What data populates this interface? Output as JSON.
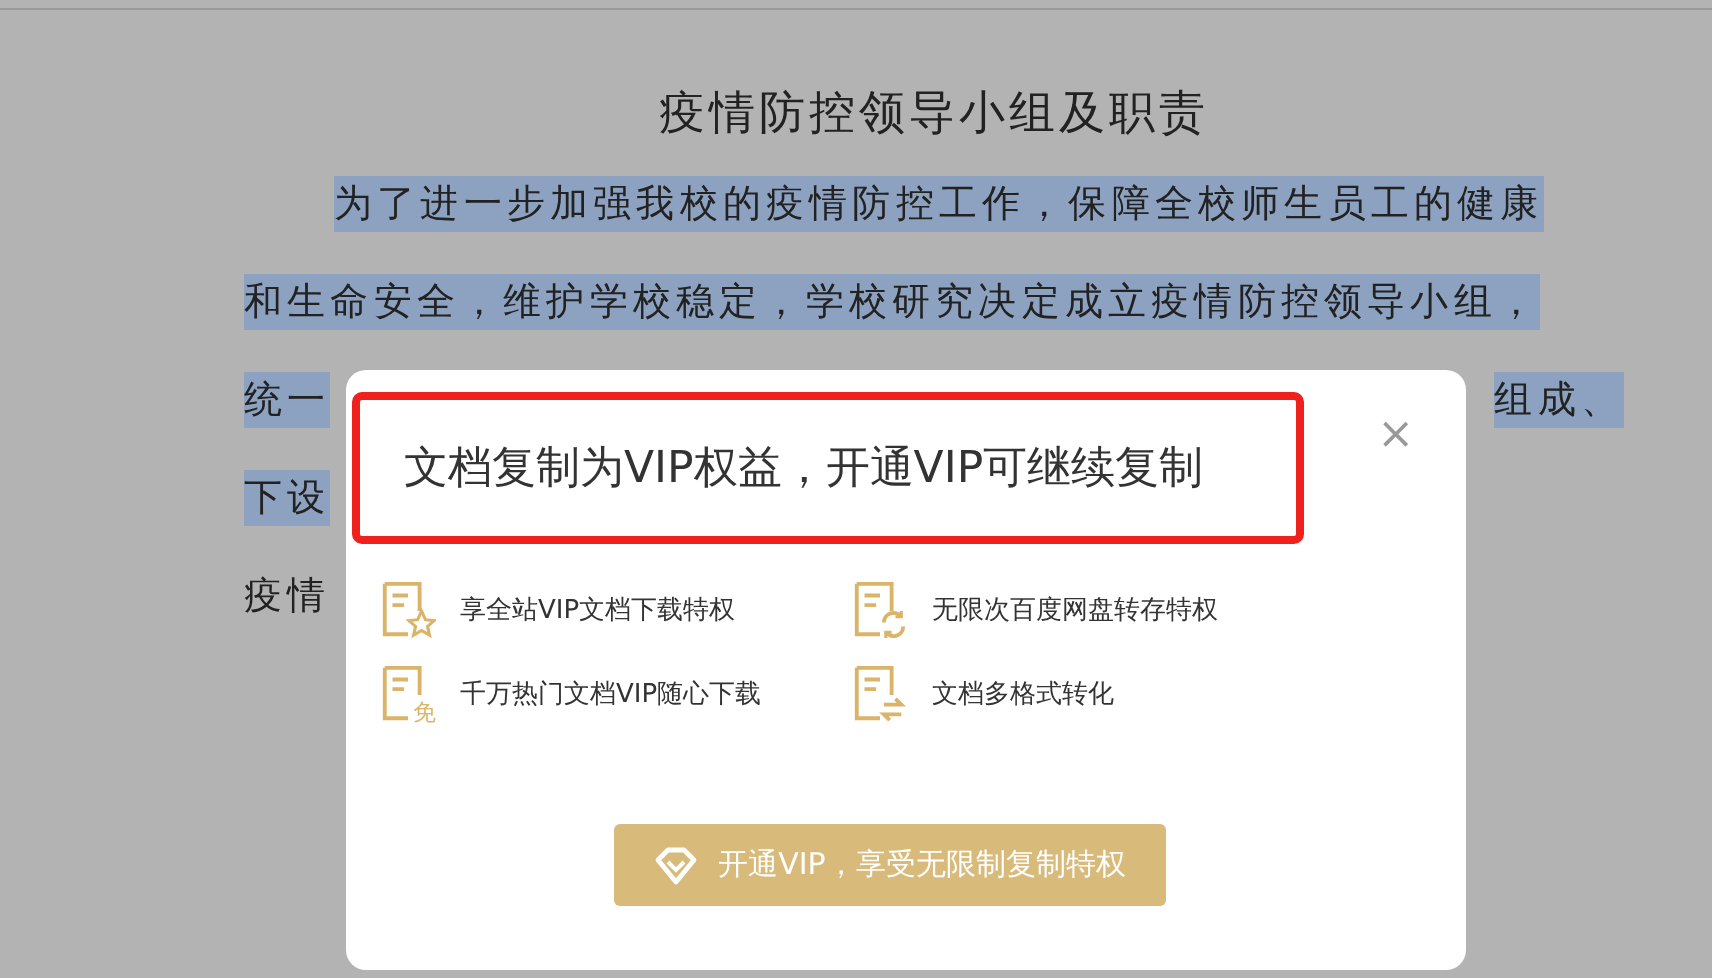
{
  "document": {
    "title": "疫情防控领导小组及职责",
    "lines": [
      {
        "kind": "first",
        "left": "为了进一步加强我校的疫情防控工作，保障全校师生员工的健康",
        "selected": true
      },
      {
        "kind": "cont",
        "left": "和生命安全，维护学校稳定，学校研究决定成立疫情防控领导小组，",
        "selected": true
      },
      {
        "kind": "cont",
        "left": "统一",
        "right": "组成、",
        "selected": true
      },
      {
        "kind": "cont",
        "left": "下设",
        "selected": true
      },
      {
        "kind": "cont",
        "left": "疫情",
        "selected": false
      }
    ]
  },
  "dialog": {
    "headline": "文档复制为VIP权益，开通VIP可继续复制",
    "close": "×",
    "features": [
      {
        "kind": "star",
        "label": "享全站VIP文档下载特权"
      },
      {
        "kind": "sync",
        "label": "无限次百度网盘转存特权"
      },
      {
        "kind": "badge",
        "badge": "免",
        "label": "千万热门文档VIP随心下载"
      },
      {
        "kind": "convert",
        "label": "文档多格式转化"
      }
    ],
    "button": "开通VIP，享受无限制复制特权"
  }
}
